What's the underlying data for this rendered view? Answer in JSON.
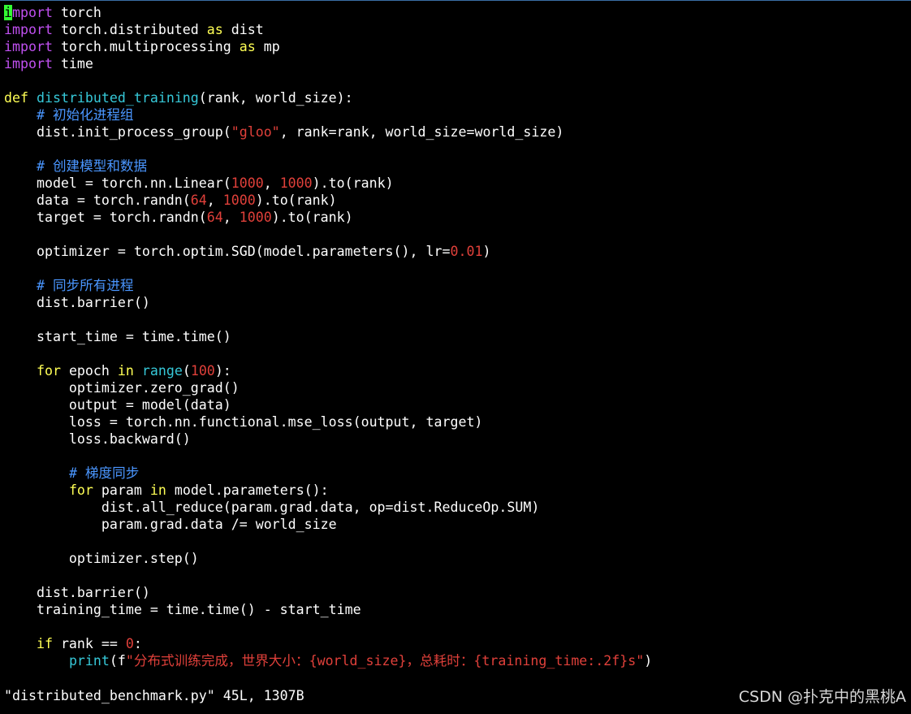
{
  "editor": {
    "colors": {
      "background": "#000000",
      "text": "#ffffff",
      "keyword": "#ffff55",
      "import_keyword": "#c050f0",
      "function_name": "#36c8d8",
      "comment": "#4a96ff",
      "string_number": "#e0403a",
      "cursor": "#33ff33"
    },
    "lines": [
      [
        {
          "t": "i",
          "c": "cursor"
        },
        {
          "t": "mport",
          "c": "imp"
        },
        {
          "t": " torch"
        }
      ],
      [
        {
          "t": "import",
          "c": "imp"
        },
        {
          "t": " torch.distributed "
        },
        {
          "t": "as",
          "c": "kw"
        },
        {
          "t": " dist"
        }
      ],
      [
        {
          "t": "import",
          "c": "imp"
        },
        {
          "t": " torch.multiprocessing "
        },
        {
          "t": "as",
          "c": "kw"
        },
        {
          "t": " mp"
        }
      ],
      [
        {
          "t": "import",
          "c": "imp"
        },
        {
          "t": " time"
        }
      ],
      [],
      [
        {
          "t": "def",
          "c": "kw"
        },
        {
          "t": " "
        },
        {
          "t": "distributed_training",
          "c": "fn"
        },
        {
          "t": "(rank, world_size):"
        }
      ],
      [
        {
          "t": "    "
        },
        {
          "t": "# 初始化进程组",
          "c": "cm"
        }
      ],
      [
        {
          "t": "    dist.init_process_group("
        },
        {
          "t": "\"gloo\"",
          "c": "str"
        },
        {
          "t": ", rank=rank, world_size=world_size)"
        }
      ],
      [],
      [
        {
          "t": "    "
        },
        {
          "t": "# 创建模型和数据",
          "c": "cm"
        }
      ],
      [
        {
          "t": "    model = torch.nn.Linear("
        },
        {
          "t": "1000",
          "c": "num"
        },
        {
          "t": ", "
        },
        {
          "t": "1000",
          "c": "num"
        },
        {
          "t": ").to(rank)"
        }
      ],
      [
        {
          "t": "    data = torch.randn("
        },
        {
          "t": "64",
          "c": "num"
        },
        {
          "t": ", "
        },
        {
          "t": "1000",
          "c": "num"
        },
        {
          "t": ").to(rank)"
        }
      ],
      [
        {
          "t": "    target = torch.randn("
        },
        {
          "t": "64",
          "c": "num"
        },
        {
          "t": ", "
        },
        {
          "t": "1000",
          "c": "num"
        },
        {
          "t": ").to(rank)"
        }
      ],
      [],
      [
        {
          "t": "    optimizer = torch.optim.SGD(model.parameters(), lr="
        },
        {
          "t": "0.01",
          "c": "num"
        },
        {
          "t": ")"
        }
      ],
      [],
      [
        {
          "t": "    "
        },
        {
          "t": "# 同步所有进程",
          "c": "cm"
        }
      ],
      [
        {
          "t": "    dist.barrier()"
        }
      ],
      [],
      [
        {
          "t": "    start_time = time.time()"
        }
      ],
      [],
      [
        {
          "t": "    "
        },
        {
          "t": "for",
          "c": "kw"
        },
        {
          "t": " epoch "
        },
        {
          "t": "in",
          "c": "kw"
        },
        {
          "t": " "
        },
        {
          "t": "range",
          "c": "fn"
        },
        {
          "t": "("
        },
        {
          "t": "100",
          "c": "num"
        },
        {
          "t": "):"
        }
      ],
      [
        {
          "t": "        optimizer.zero_grad()"
        }
      ],
      [
        {
          "t": "        output = model(data)"
        }
      ],
      [
        {
          "t": "        loss = torch.nn.functional.mse_loss(output, target)"
        }
      ],
      [
        {
          "t": "        loss.backward()"
        }
      ],
      [],
      [
        {
          "t": "        "
        },
        {
          "t": "# 梯度同步",
          "c": "cm"
        }
      ],
      [
        {
          "t": "        "
        },
        {
          "t": "for",
          "c": "kw"
        },
        {
          "t": " param "
        },
        {
          "t": "in",
          "c": "kw"
        },
        {
          "t": " model.parameters():"
        }
      ],
      [
        {
          "t": "            dist.all_reduce(param.grad.data, op=dist.ReduceOp.SUM)"
        }
      ],
      [
        {
          "t": "            param.grad.data /= world_size"
        }
      ],
      [],
      [
        {
          "t": "        optimizer.step()"
        }
      ],
      [],
      [
        {
          "t": "    dist.barrier()"
        }
      ],
      [
        {
          "t": "    training_time = time.time() - start_time"
        }
      ],
      [],
      [
        {
          "t": "    "
        },
        {
          "t": "if",
          "c": "kw"
        },
        {
          "t": " rank == "
        },
        {
          "t": "0",
          "c": "num"
        },
        {
          "t": ":"
        }
      ],
      [
        {
          "t": "        "
        },
        {
          "t": "print",
          "c": "fn"
        },
        {
          "t": "(f"
        },
        {
          "t": "\"分布式训练完成，世界大小：{world_size}，总耗时：{training_time:.2f}s\"",
          "c": "str"
        },
        {
          "t": ")"
        }
      ]
    ]
  },
  "status": {
    "text": "\"distributed_benchmark.py\" 45L, 1307B"
  },
  "watermark": {
    "text": "CSDN @扑克中的黑桃A"
  }
}
